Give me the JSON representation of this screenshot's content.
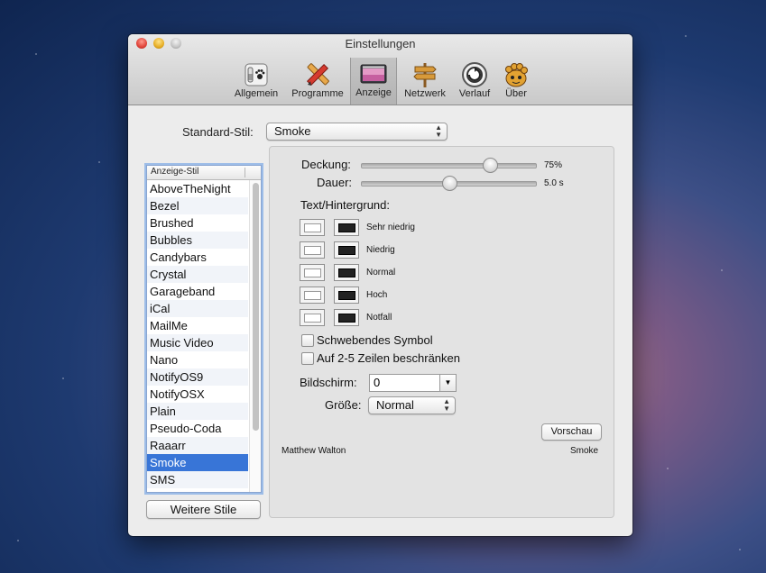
{
  "window": {
    "title": "Einstellungen"
  },
  "toolbar": {
    "items": [
      {
        "label": "Allgemein",
        "icon": "switch-paw-icon"
      },
      {
        "label": "Programme",
        "icon": "pencil-ruler-icon"
      },
      {
        "label": "Anzeige",
        "icon": "display-window-icon",
        "active": true
      },
      {
        "label": "Netzwerk",
        "icon": "signpost-icon"
      },
      {
        "label": "Verlauf",
        "icon": "history-clock-icon"
      },
      {
        "label": "Über",
        "icon": "growl-paw-icon"
      }
    ]
  },
  "standard_style": {
    "label": "Standard-Stil:",
    "value": "Smoke"
  },
  "style_list": {
    "header": "Anzeige-Stil",
    "items": [
      "AboveTheNight",
      "Bezel",
      "Brushed",
      "Bubbles",
      "Candybars",
      "Crystal",
      "Garageband",
      "iCal",
      "MailMe",
      "Music Video",
      "Nano",
      "NotifyOS9",
      "NotifyOSX",
      "Plain",
      "Pseudo-Coda",
      "Raaarr",
      "Smoke",
      "SMS"
    ],
    "selected": "Smoke",
    "more_button": "Weitere Stile"
  },
  "settings": {
    "opacity": {
      "label": "Deckung:",
      "value_text": "75%",
      "value": 0.75
    },
    "duration": {
      "label": "Dauer:",
      "value_text": "5.0 s",
      "value": 0.5
    },
    "text_bg_label": "Text/Hintergrund:",
    "priorities": [
      "Sehr niedrig",
      "Niedrig",
      "Normal",
      "Hoch",
      "Notfall"
    ],
    "floating_icon": {
      "label": "Schwebendes Symbol",
      "checked": false
    },
    "limit_lines": {
      "label": "Auf 2-5 Zeilen beschränken",
      "checked": false
    },
    "screen": {
      "label": "Bildschirm:",
      "value": "0"
    },
    "size": {
      "label": "Größe:",
      "value": "Normal"
    },
    "preview_button": "Vorschau",
    "author": "Matthew Walton",
    "style_name": "Smoke"
  },
  "colors": {
    "selection": "#3875d7",
    "text_swatch": "#ffffff",
    "background_swatch": "#222222"
  }
}
